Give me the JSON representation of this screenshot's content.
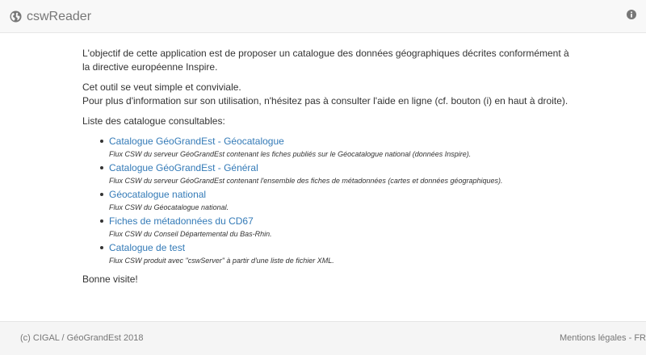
{
  "navbar": {
    "title": "cswReader",
    "brand_icon": "globe-icon",
    "help_icon": "info-icon"
  },
  "intro": {
    "line1": "L'objectif de cette application est de proposer un catalogue des données géographiques décrites conformément à",
    "line2": "la directive européenne Inspire.",
    "line3": "Cet outil se veut simple et conviviale.",
    "line4": "Pour plus d'information sur son utilisation, n'hésitez pas à consulter l'aide en ligne (cf. bouton (i) en haut à droite)."
  },
  "catalogues": {
    "heading": "Liste des catalogue consultables:",
    "items": [
      {
        "name": "Catalogue GéoGrandEst - Géocatalogue",
        "description": "Flux CSW du serveur GéoGrandEst contenant les fiches publiés sur le Géocatalogue national (données Inspire)."
      },
      {
        "name": "Catalogue GéoGrandEst - Général",
        "description": "Flux CSW du serveur GéoGrandEst contenant l'ensemble des fiches de métadonnées (cartes et données géographiques)."
      },
      {
        "name": "Géocatalogue national",
        "description": "Flux CSW du Géocatalogue national."
      },
      {
        "name": "Fiches de métadonnées du CD67",
        "description": "Flux CSW du Conseil Départemental du Bas-Rhin."
      },
      {
        "name": "Catalogue de test",
        "description": "Flux CSW produit avec \"cswServer\" à partir d'une liste de fichier XML."
      }
    ]
  },
  "closing": "Bonne visite!",
  "footer": {
    "copyright": "(c) CIGAL / GéoGrandEst 2018",
    "legal": "Mentions légales - FR"
  },
  "colors": {
    "link": "#337ab7",
    "navbar_bg": "#f8f8f8",
    "footer_bg": "#f5f5f5",
    "muted_text": "#777777"
  }
}
